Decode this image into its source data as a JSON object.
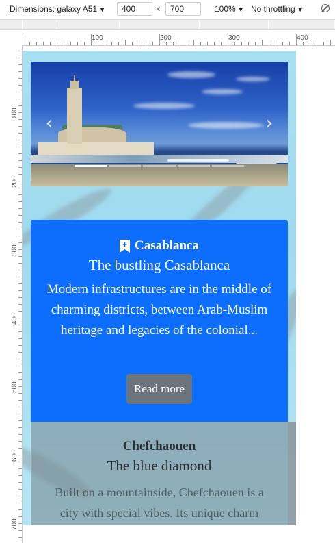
{
  "devtools": {
    "dimensions_label": "Dimensions: galaxy A51",
    "width_value": "400",
    "height_value": "700",
    "times": "×",
    "zoom": "100%",
    "throttling": "No throttling",
    "caret": "▼"
  },
  "ruler": {
    "x_labels": [
      "100",
      "200",
      "300",
      "400"
    ],
    "y_labels": [
      "100",
      "200",
      "300",
      "400",
      "500",
      "600",
      "700"
    ]
  },
  "carousel": {
    "prev_glyph": "‹",
    "next_glyph": "›",
    "indicator_count": 5,
    "active_index": 0
  },
  "cards": [
    {
      "title": "Casablanca",
      "subtitle": "The bustling Casablanca",
      "text": "Modern infrastructures are in the middle of charming districts, between Arab-Muslim heritage and legacies of the colonial...",
      "button": "Read more"
    },
    {
      "title": "Chefchaouen",
      "subtitle": "The blue diamond",
      "text": "Built on a mountainside, Chefchaouen is a city with special vibes. Its unique charm"
    }
  ],
  "colors": {
    "primary": "#0d6efd",
    "secondary_button": "#6c757d"
  }
}
